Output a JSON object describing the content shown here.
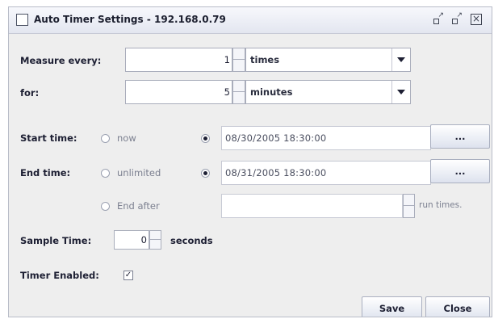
{
  "window": {
    "title": "Auto Timer Settings - 192.168.0.79",
    "icons": [
      "app-icon",
      "minimize-icon",
      "maximize-icon",
      "close-icon"
    ]
  },
  "measure": {
    "label": "Measure every:",
    "value": "1",
    "unit": "times"
  },
  "for": {
    "label": "for:",
    "value": "5",
    "unit": "minutes"
  },
  "start": {
    "label": "Start time:",
    "option_now": "now",
    "selected": "date",
    "date": "08/30/2005 18:30:00",
    "button_label": "..."
  },
  "end": {
    "label": "End time:",
    "option_unlimited": "unlimited",
    "selected": "date",
    "date": "08/31/2005 18:30:00",
    "button_label": "...",
    "option_end_after": "End after",
    "run_times_label": "run times."
  },
  "sample": {
    "label": "Sample Time:",
    "value": "0",
    "unit": "seconds"
  },
  "timer": {
    "label": "Timer Enabled:",
    "checked": true
  },
  "buttons": {
    "save": "Save",
    "close": "Close"
  }
}
